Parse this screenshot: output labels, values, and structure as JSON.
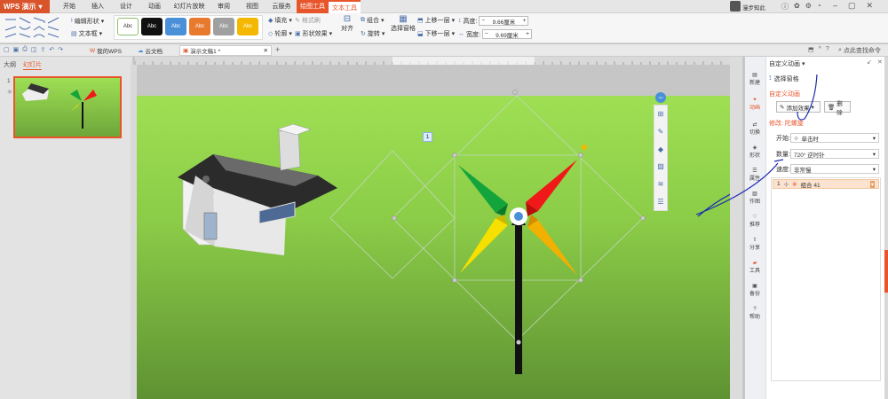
{
  "app": {
    "name": "WPS 演示"
  },
  "tabs": [
    "开始",
    "插入",
    "设计",
    "动画",
    "幻灯片放映",
    "审阅",
    "视图",
    "云服务",
    "绘图工具",
    "文本工具"
  ],
  "active_tab_index": 8,
  "user": {
    "name": "漫步知此"
  },
  "ribbon": {
    "edit_shape": "编辑形状",
    "text_box": "文本框",
    "style_labels": [
      "Abc",
      "Abc",
      "Abc",
      "Abc",
      "Abc",
      "Abc"
    ],
    "style_colors": [
      "#ffffff",
      "#111111",
      "#4a90d9",
      "#e87a2e",
      "#a0a0a0",
      "#f5b800"
    ],
    "fill": "填充",
    "format_painter": "格式刷",
    "outline": "轮廓",
    "shape_effects": "形状效果",
    "align": "对齐",
    "group": "组合",
    "rotate": "旋转",
    "selection_pane": "选择窗格",
    "bring_forward": "上移一层",
    "send_backward": "下移一层",
    "height_label": "高度:",
    "height_value": "9.66厘米",
    "width_label": "宽度:",
    "width_value": "9.69厘米",
    "search": "点此查找命令"
  },
  "doc_tabs": [
    "我的WPS",
    "云文档",
    "演示文稿1 *"
  ],
  "left_pane": {
    "outline_tab": "大纲",
    "slides_tab": "幻灯片",
    "slide_number": "1"
  },
  "slide": {
    "badge": "1"
  },
  "right_sidebar": [
    "新建",
    "动画",
    "切换",
    "形状",
    "属性",
    "作图",
    "推荐",
    "分享",
    "工具",
    "备份",
    "帮助"
  ],
  "panel": {
    "title": "自定义动画",
    "selection_pane": "选择窗格",
    "section_title": "自定义动画",
    "add_effect": "添加效果",
    "delete": "删除",
    "modify_title": "修改: 陀螺旋",
    "start_label": "开始:",
    "start_value": "单击时",
    "amount_label": "数量:",
    "amount_value": "720° 逆时针",
    "speed_label": "速度:",
    "speed_value": "非常慢",
    "item_index": "1",
    "item_name": "组合 41"
  }
}
